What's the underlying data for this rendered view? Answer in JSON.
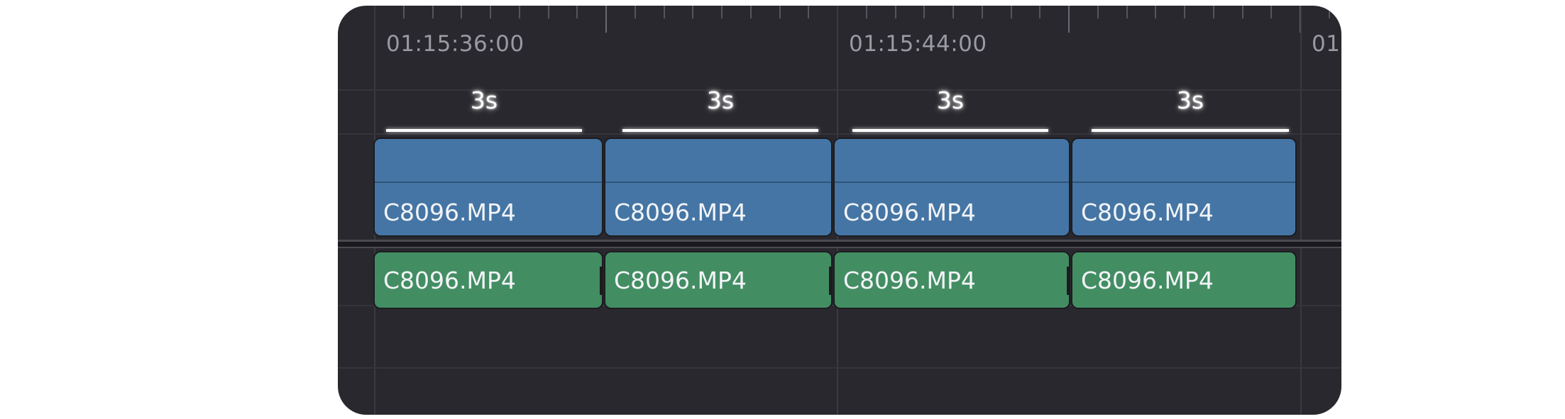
{
  "ruler": {
    "timecodes": [
      "01:15:36:00",
      "01:15:44:00",
      "01"
    ]
  },
  "durations": [
    {
      "label": "3s"
    },
    {
      "label": "3s"
    },
    {
      "label": "3s"
    },
    {
      "label": "3s"
    }
  ],
  "video_track": {
    "clips": [
      {
        "name": "C8096.MP4"
      },
      {
        "name": "C8096.MP4"
      },
      {
        "name": "C8096.MP4"
      },
      {
        "name": "C8096.MP4"
      }
    ]
  },
  "audio_track": {
    "clips": [
      {
        "name": "C8096.MP4"
      },
      {
        "name": "C8096.MP4"
      },
      {
        "name": "C8096.MP4"
      },
      {
        "name": "C8096.MP4"
      }
    ]
  },
  "colors": {
    "background": "#28282e",
    "video_clip": "#4575a4",
    "audio_clip": "#438d63",
    "timecode_text": "#9a9aa2"
  }
}
